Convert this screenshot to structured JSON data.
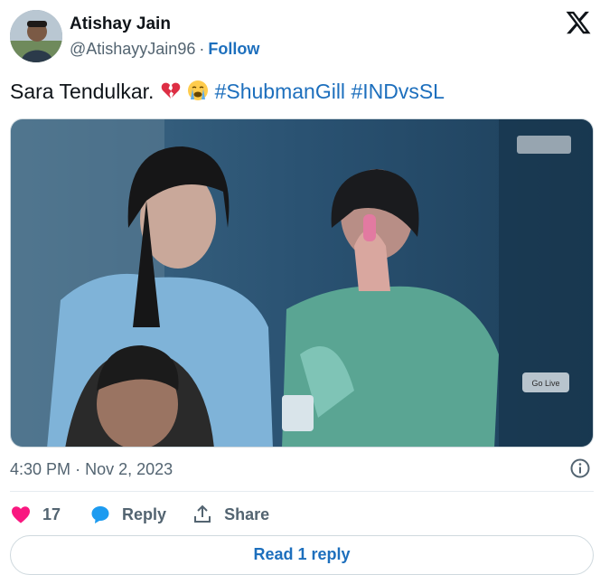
{
  "author": {
    "name": "Atishay Jain",
    "handle": "@AtishayyJain96",
    "separator": "·",
    "follow_label": "Follow"
  },
  "brand": {
    "logo_icon": "x-logo-icon"
  },
  "tweet": {
    "text": "Sara Tendulkar.",
    "emojis": [
      "broken-heart-emoji",
      "loudly-crying-face-emoji"
    ],
    "hashtags": [
      "#ShubmanGill",
      "#INDvsSL"
    ]
  },
  "media": {
    "type": "video-still",
    "overlay_button": "Go Live",
    "watermark_icon": "disney-hotstar-logo"
  },
  "meta": {
    "time": "4:30 PM",
    "separator": "·",
    "date": "Nov 2, 2023",
    "info_icon": "info-icon"
  },
  "actions": {
    "like_count": "17",
    "reply_label": "Reply",
    "share_label": "Share"
  },
  "footer": {
    "read_replies_label": "Read 1 reply"
  },
  "colors": {
    "link": "#1d6fbd",
    "muted": "#536471",
    "heart": "#f91880",
    "text": "#0f1419"
  }
}
